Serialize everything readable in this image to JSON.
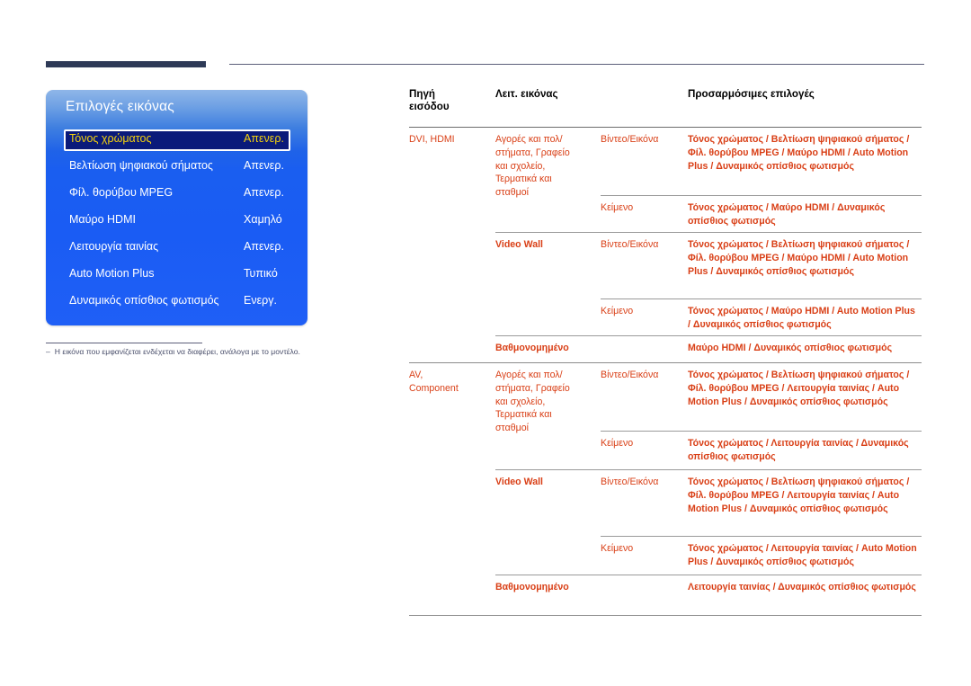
{
  "osd": {
    "title": "Επιλογές εικόνας",
    "rows": [
      {
        "label": "Τόνος χρώματος",
        "value": "Απενερ.",
        "selected": true
      },
      {
        "label": "Βελτίωση ψηφιακού σήματος",
        "value": "Απενερ.",
        "selected": false
      },
      {
        "label": "Φίλ. θορύβου MPEG",
        "value": "Απενερ.",
        "selected": false
      },
      {
        "label": "Μαύρο HDMI",
        "value": "Χαμηλό",
        "selected": false
      },
      {
        "label": "Λειτουργία ταινίας",
        "value": "Απενερ.",
        "selected": false
      },
      {
        "label": "Auto Motion Plus",
        "value": "Τυπικό",
        "selected": false
      },
      {
        "label": "Δυναμικός οπίσθιος φωτισμός",
        "value": "Ενεργ.",
        "selected": false
      }
    ]
  },
  "footnote": {
    "dash": "–",
    "text": "Η εικόνα που εμφανίζεται ενδέχεται να διαφέρει, ανάλογα με το μοντέλο."
  },
  "table": {
    "headers": {
      "source": "Πηγή\nεισόδου",
      "source_line1": "Πηγή",
      "source_line2": "εισόδου",
      "picture_mode": "Λειτ. εικόνας",
      "adjustable": "Προσαρμόσιμες επιλογές"
    },
    "rows": [
      {
        "id": "dvi-hdmi-video",
        "source": "DVI, HDMI",
        "mode": "Αγορές και πολ/\nστήματα, Γραφείο\nκαι σχολείο,\nΤερματικά και\nσταθμοί",
        "type": "Βίντεο/Εικόνα",
        "options": "Τόνος χρώματος / Βελτίωση ψηφιακού σήματος / Φίλ. θορύβου MPEG / Μαύρο HDMI / Auto Motion Plus / Δυναμικός οπίσθιος φωτισμός"
      },
      {
        "id": "dvi-hdmi-text",
        "source": "",
        "mode": "",
        "type": "Κείμενο",
        "options": "Τόνος χρώματος / Μαύρο HDMI / Δυναμικός οπίσθιος φωτισμός"
      },
      {
        "id": "dvi-hdmi-videowall-video",
        "source": "",
        "mode": "Video Wall",
        "type": "Βίντεο/Εικόνα",
        "options": "Τόνος χρώματος / Βελτίωση ψηφιακού σήματος / Φίλ. θορύβου MPEG / Μαύρο HDMI / Auto Motion Plus / Δυναμικός οπίσθιος φωτισμός"
      },
      {
        "id": "dvi-hdmi-videowall-text",
        "source": "",
        "mode": "",
        "type": "Κείμενο",
        "options": "Τόνος χρώματος / Μαύρο HDMI / Auto Motion Plus / Δυναμικός οπίσθιος φωτισμός"
      },
      {
        "id": "dvi-hdmi-calibrated",
        "source": "",
        "mode": "Βαθμονομημένο",
        "type": "",
        "options": "Μαύρο HDMI / Δυναμικός οπίσθιος φωτισμός"
      },
      {
        "id": "av-component-video",
        "source": "AV,\nComponent",
        "mode": "Αγορές και πολ/\nστήματα, Γραφείο\nκαι σχολείο,\nΤερματικά και\nσταθμοί",
        "type": "Βίντεο/Εικόνα",
        "options": "Τόνος χρώματος / Βελτίωση ψηφιακού σήματος / Φίλ. θορύβου MPEG / Λειτουργία ταινίας / Auto Motion Plus / Δυναμικός οπίσθιος φωτισμός"
      },
      {
        "id": "av-component-text",
        "source": "",
        "mode": "",
        "type": "Κείμενο",
        "options": "Τόνος χρώματος / Λειτουργία ταινίας / Δυναμικός οπίσθιος φωτισμός"
      },
      {
        "id": "av-component-videowall-video",
        "source": "",
        "mode": "Video Wall",
        "type": "Βίντεο/Εικόνα",
        "options": "Τόνος χρώματος / Βελτίωση ψηφιακού σήματος / Φίλ. θορύβου MPEG / Λειτουργία ταινίας / Auto Motion Plus / Δυναμικός οπίσθιος φωτισμός"
      },
      {
        "id": "av-component-videowall-text",
        "source": "",
        "mode": "",
        "type": "Κείμενο",
        "options": "Τόνος χρώματος / Λειτουργία ταινίας / Auto Motion Plus / Δυναμικός οπίσθιος φωτισμός"
      },
      {
        "id": "av-component-calibrated",
        "source": "",
        "mode": "Βαθμονομημένο",
        "type": "",
        "options": "Λειτουργία ταινίας / Δυναμικός οπίσθιος φωτισμός"
      }
    ]
  },
  "colors": {
    "osd_selected_bg": "#0a1a7a",
    "osd_selected_text": "#f5d20c",
    "osd_panel_blue": "#1a5cf4",
    "table_text": "#d93f16",
    "rule_navy": "#2e3a57"
  }
}
